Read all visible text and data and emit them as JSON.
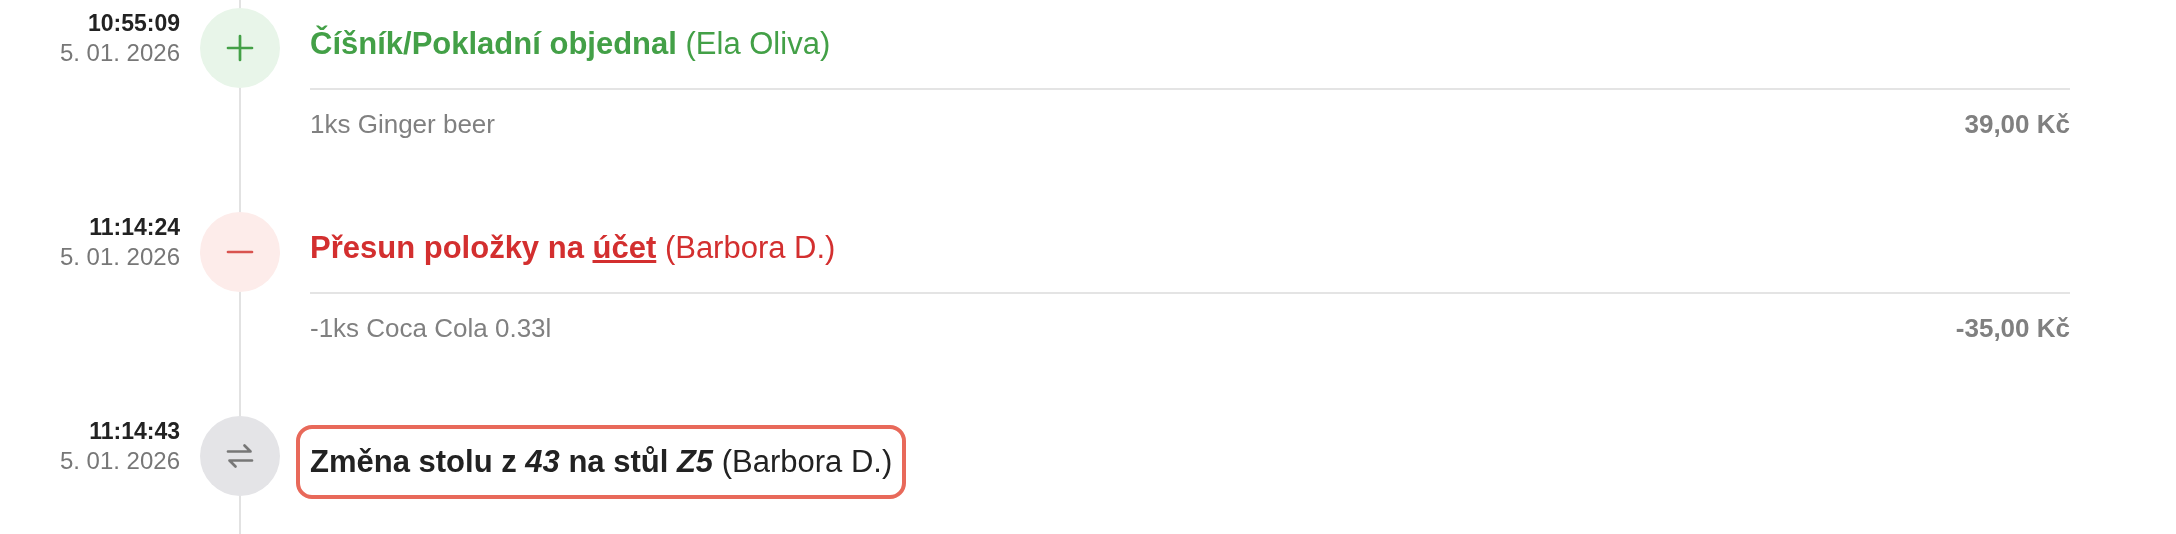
{
  "entries": [
    {
      "time": "10:55:09",
      "date": "5. 01. 2026",
      "kind": "add",
      "highlighted": false,
      "title": [
        {
          "text": "Číšník/Pokladní objednal",
          "bold": true,
          "italic": false,
          "underline": false
        },
        {
          "text": " (Ela Oliva)",
          "bold": false,
          "italic": false,
          "underline": false
        }
      ],
      "items": [
        {
          "name": "1ks Ginger beer",
          "price": "39,00 Kč"
        }
      ]
    },
    {
      "time": "11:14:24",
      "date": "5. 01. 2026",
      "kind": "remove",
      "highlighted": false,
      "title": [
        {
          "text": "Přesun položky na ",
          "bold": true,
          "italic": false,
          "underline": false
        },
        {
          "text": "účet",
          "bold": true,
          "italic": false,
          "underline": true
        },
        {
          "text": " (Barbora D.)",
          "bold": false,
          "italic": false,
          "underline": false
        }
      ],
      "items": [
        {
          "name": "-1ks Coca Cola 0.33l",
          "price": "-35,00 Kč"
        }
      ]
    },
    {
      "time": "11:14:43",
      "date": "5. 01. 2026",
      "kind": "move",
      "highlighted": true,
      "title": [
        {
          "text": "Změna stolu z ",
          "bold": true,
          "italic": false,
          "underline": false
        },
        {
          "text": "43",
          "bold": true,
          "italic": true,
          "underline": false
        },
        {
          "text": " na stůl ",
          "bold": true,
          "italic": false,
          "underline": false
        },
        {
          "text": "Z5",
          "bold": true,
          "italic": true,
          "underline": false
        },
        {
          "text": " (Barbora D.)",
          "bold": false,
          "italic": false,
          "underline": false
        }
      ]
    }
  ]
}
